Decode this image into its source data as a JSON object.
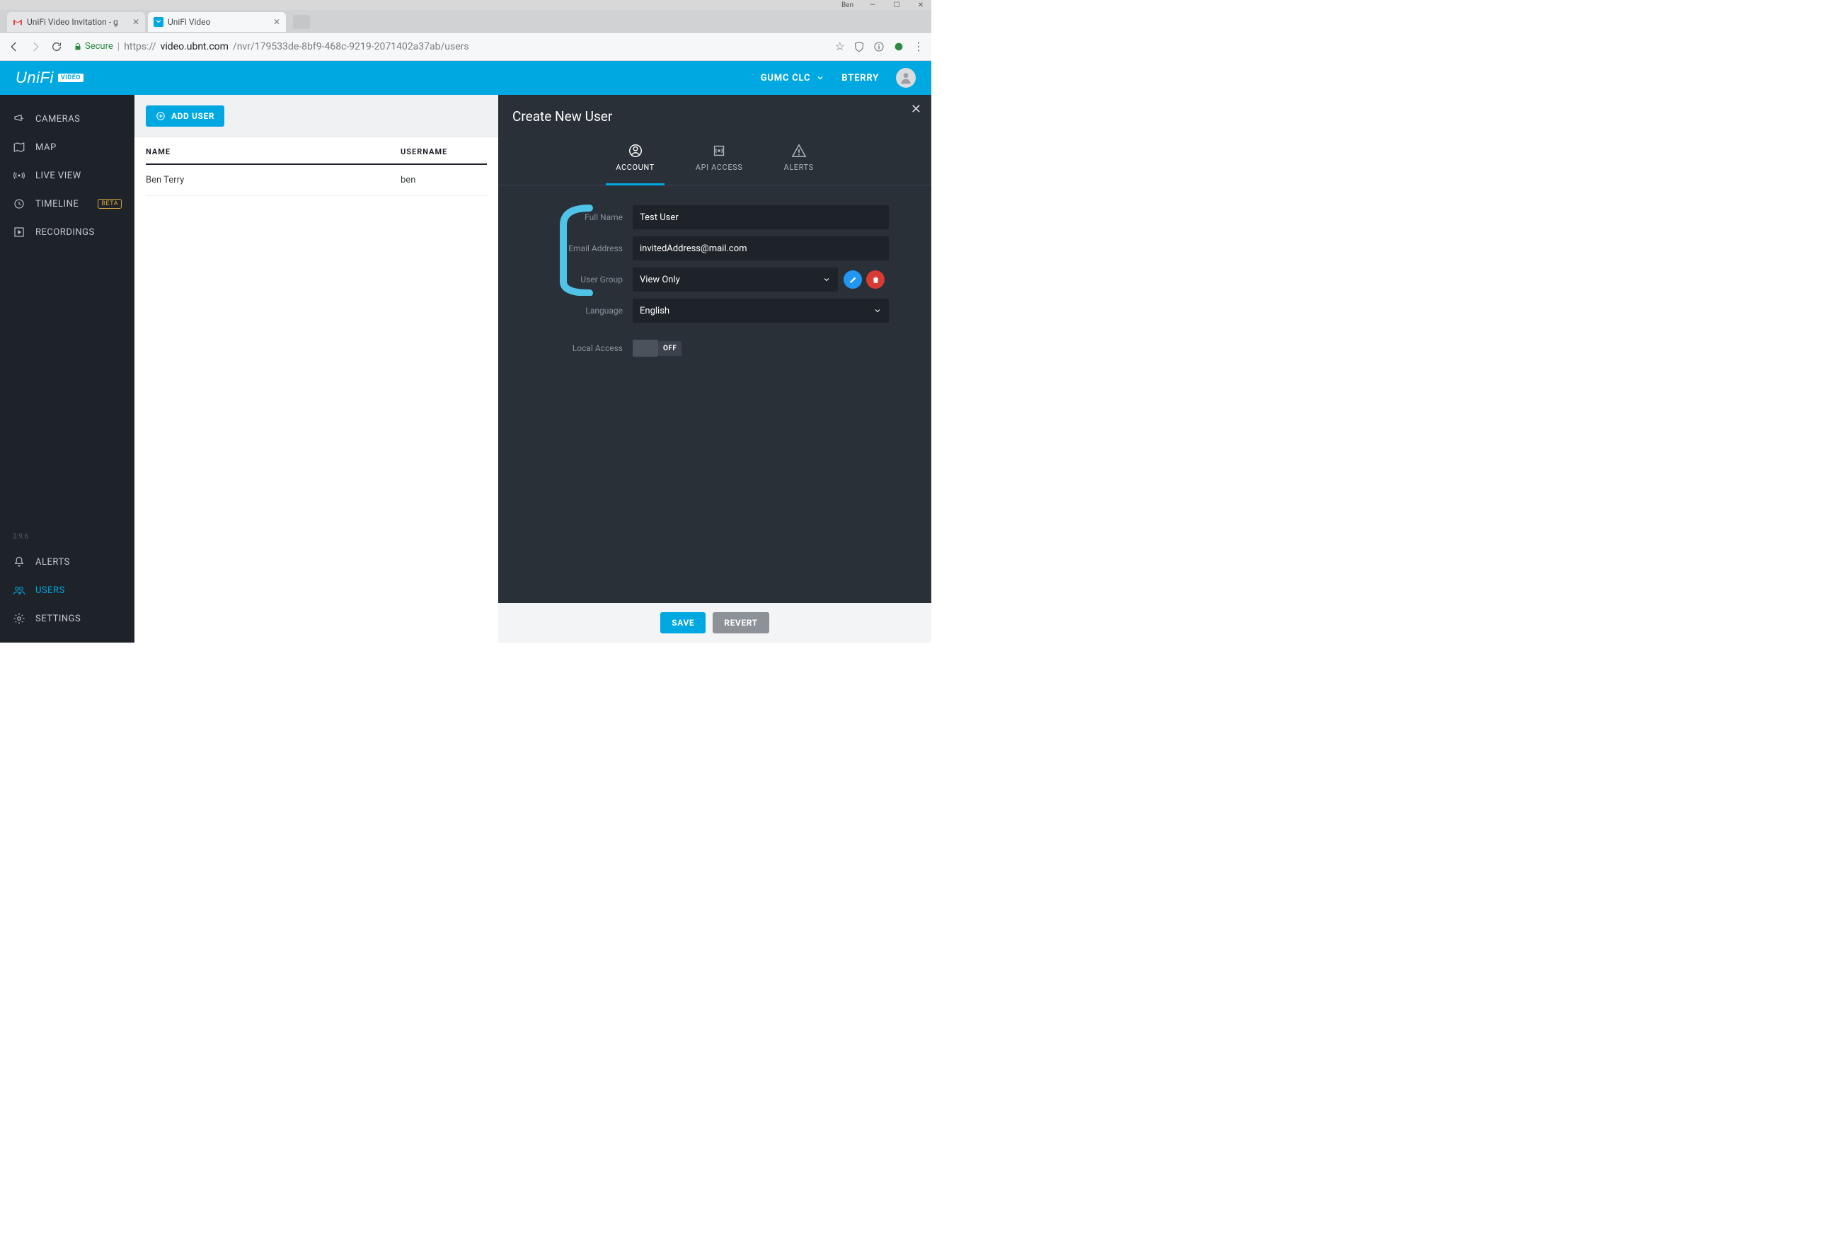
{
  "window": {
    "profile": "Ben"
  },
  "browser": {
    "tabs": [
      {
        "title": "UniFi Video Invitation - g",
        "active": false
      },
      {
        "title": "UniFi Video",
        "active": true
      }
    ],
    "secure_label": "Secure",
    "url_prefix": "https://",
    "url_host": "video.ubnt.com",
    "url_path": "/nvr/179533de-8bf9-468c-9219-2071402a37ab/users"
  },
  "header": {
    "logo_main": "UniFi",
    "logo_badge": "VIDEO",
    "org": "GUMC CLC",
    "user": "BTERRY"
  },
  "sidebar": {
    "items": [
      {
        "label": "CAMERAS"
      },
      {
        "label": "MAP"
      },
      {
        "label": "LIVE VIEW"
      },
      {
        "label": "TIMELINE",
        "beta": "BETA"
      },
      {
        "label": "RECORDINGS"
      }
    ],
    "version": "3.9.6",
    "bottom": [
      {
        "label": "ALERTS"
      },
      {
        "label": "USERS"
      },
      {
        "label": "SETTINGS"
      }
    ]
  },
  "users": {
    "add_button": "ADD USER",
    "col_name": "NAME",
    "col_username": "USERNAME",
    "rows": [
      {
        "name": "Ben Terry",
        "username": "ben"
      }
    ]
  },
  "drawer": {
    "title": "Create New User",
    "tabs": {
      "account": "ACCOUNT",
      "api": "API ACCESS",
      "alerts": "ALERTS"
    },
    "labels": {
      "full_name": "Full Name",
      "email": "Email Address",
      "group": "User Group",
      "language": "Language",
      "local_access": "Local Access"
    },
    "values": {
      "full_name": "Test User",
      "email": "invitedAddress@mail.com",
      "group": "View Only",
      "language": "English",
      "local_access": "OFF"
    },
    "save": "SAVE",
    "revert": "REVERT"
  }
}
